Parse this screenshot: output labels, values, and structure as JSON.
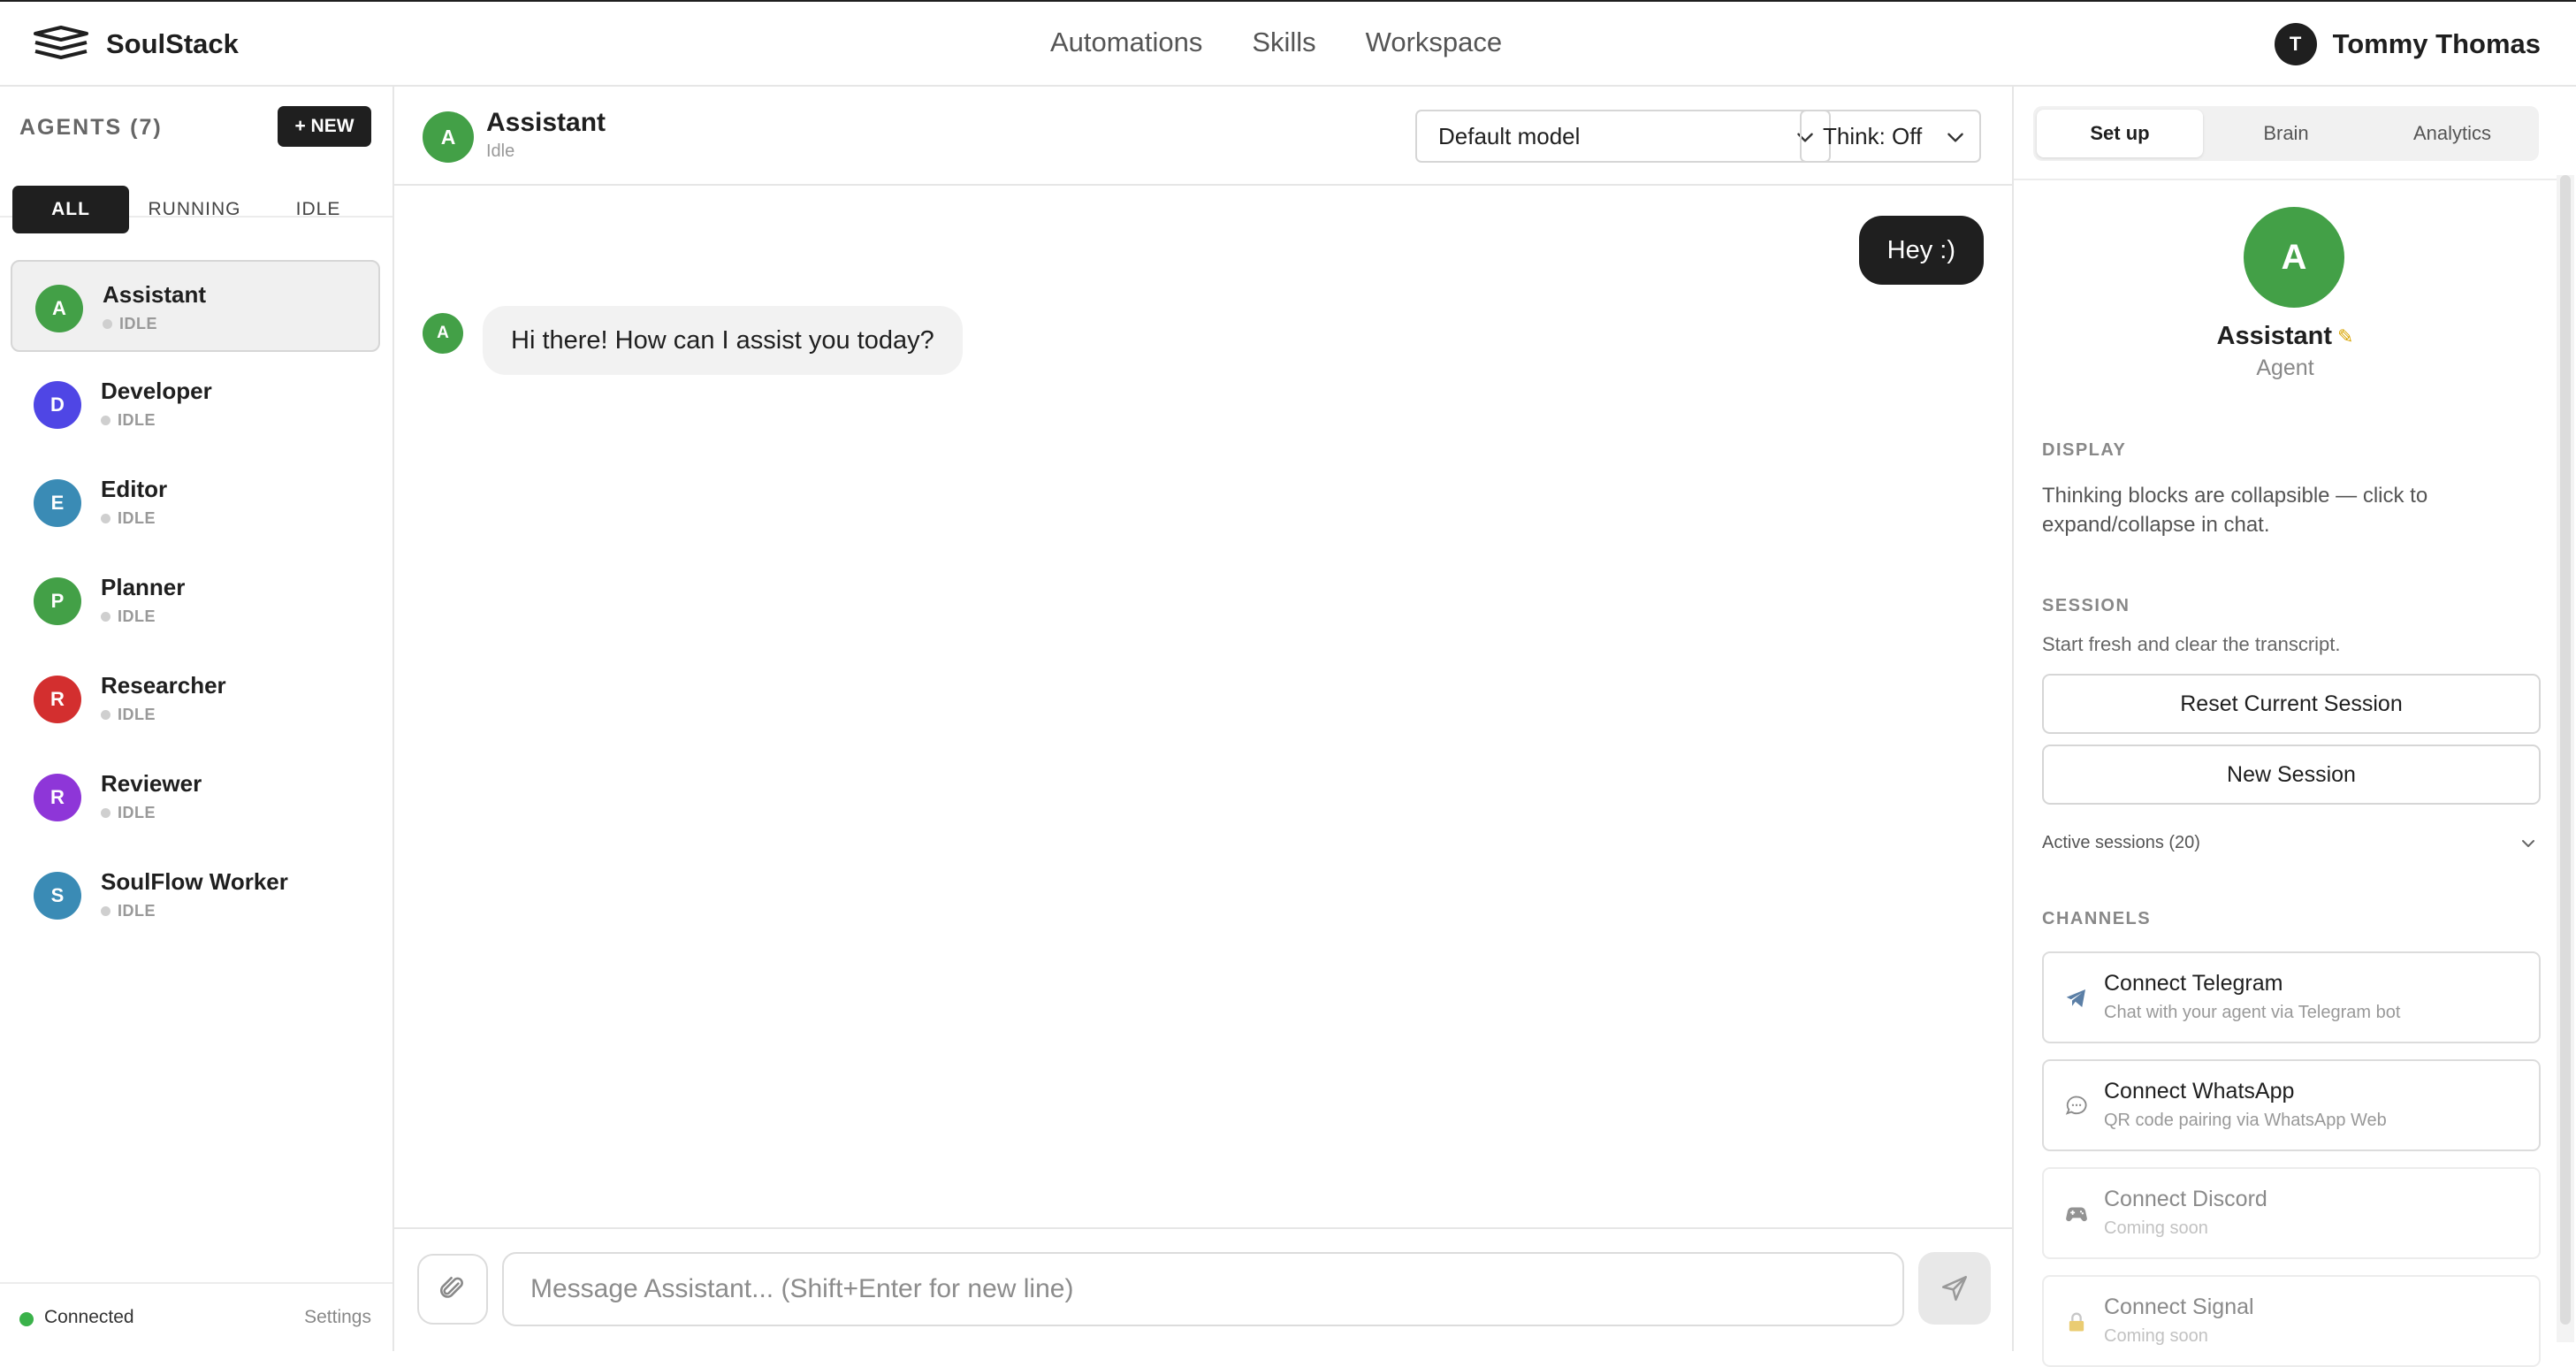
{
  "app": {
    "brand_name": "SoulStack"
  },
  "nav": {
    "items": [
      "Automations",
      "Skills",
      "Workspace"
    ]
  },
  "user": {
    "initial": "T",
    "name": "Tommy Thomas"
  },
  "sidebar": {
    "title": "AGENTS (7)",
    "new_button": "+ NEW",
    "filters": [
      "ALL",
      "RUNNING",
      "IDLE"
    ],
    "active_filter": "ALL",
    "agents": [
      {
        "initial": "A",
        "name": "Assistant",
        "status": "IDLE",
        "color": "#43a047",
        "selected": true
      },
      {
        "initial": "D",
        "name": "Developer",
        "status": "IDLE",
        "color": "#4f46e5"
      },
      {
        "initial": "E",
        "name": "Editor",
        "status": "IDLE",
        "color": "#3a8bb5"
      },
      {
        "initial": "P",
        "name": "Planner",
        "status": "IDLE",
        "color": "#43a047"
      },
      {
        "initial": "R",
        "name": "Researcher",
        "status": "IDLE",
        "color": "#d32f2f"
      },
      {
        "initial": "R",
        "name": "Reviewer",
        "status": "IDLE",
        "color": "#8e36d8"
      },
      {
        "initial": "S",
        "name": "SoulFlow Worker",
        "status": "IDLE",
        "color": "#3a8bb5"
      }
    ],
    "connection": "Connected",
    "settings_label": "Settings",
    "connected_color": "#3ab24a"
  },
  "chat": {
    "agent_initial": "A",
    "agent_name": "Assistant",
    "agent_status": "Idle",
    "model_select": "Default model",
    "think_select": "Think: Off",
    "messages": [
      {
        "role": "user",
        "text": "Hey :)"
      },
      {
        "role": "assistant",
        "initial": "A",
        "text": "Hi there! How can I assist you today?"
      }
    ],
    "input_placeholder": "Message Assistant... (Shift+Enter for new line)"
  },
  "panel": {
    "tabs": [
      "Set up",
      "Brain",
      "Analytics"
    ],
    "active_tab": "Set up",
    "agent_initial": "A",
    "agent_name": "Assistant",
    "agent_role": "Agent",
    "display_label": "DISPLAY",
    "display_text": "Thinking blocks are collapsible — click to expand/collapse in chat.",
    "session_label": "SESSION",
    "session_text": "Start fresh and clear the transcript.",
    "reset_button": "Reset Current Session",
    "new_session_button": "New Session",
    "active_sessions": "Active sessions (20)",
    "channels_label": "CHANNELS",
    "channels": [
      {
        "icon": "telegram-icon",
        "title": "Connect Telegram",
        "subtitle": "Chat with your agent via Telegram bot",
        "enabled": true
      },
      {
        "icon": "whatsapp-icon",
        "title": "Connect WhatsApp",
        "subtitle": "QR code pairing via WhatsApp Web",
        "enabled": true
      },
      {
        "icon": "discord-icon",
        "title": "Connect Discord",
        "subtitle": "Coming soon",
        "enabled": false
      },
      {
        "icon": "signal-icon",
        "title": "Connect Signal",
        "subtitle": "Coming soon",
        "enabled": false
      }
    ]
  }
}
